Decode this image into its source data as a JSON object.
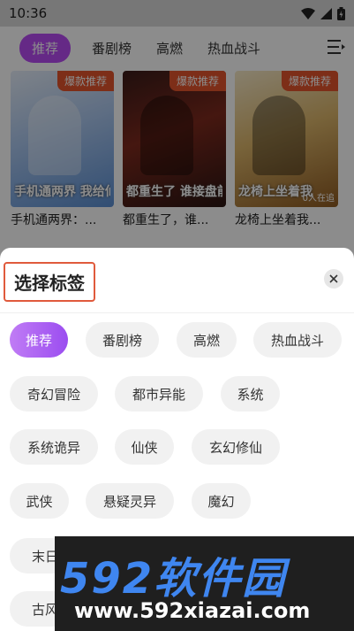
{
  "status_bar": {
    "time": "10:36"
  },
  "background": {
    "tabs": [
      "推荐",
      "番剧榜",
      "高燃",
      "热血战斗"
    ],
    "cards": [
      {
        "badge": "爆款推荐",
        "cover_text": "手机通两界 我给仙女送泡面",
        "title": "手机通两界：..."
      },
      {
        "badge": "爆款推荐",
        "cover_text": "都重生了 谁接盘前女友",
        "title": "都重生了，谁..."
      },
      {
        "badge": "爆款推荐",
        "cover_text": "龙椅上坐着我",
        "views": "0人在追",
        "title": "龙椅上坐着我..."
      }
    ]
  },
  "sheet": {
    "title": "选择标签",
    "tags": [
      {
        "label": "推荐",
        "selected": true
      },
      {
        "label": "番剧榜",
        "selected": false
      },
      {
        "label": "高燃",
        "selected": false
      },
      {
        "label": "热血战斗",
        "selected": false
      },
      {
        "label": "奇幻冒险",
        "selected": false
      },
      {
        "label": "都市异能",
        "selected": false
      },
      {
        "label": "系统",
        "selected": false
      },
      {
        "label": "系统诡异",
        "selected": false
      },
      {
        "label": "仙侠",
        "selected": false
      },
      {
        "label": "玄幻修仙",
        "selected": false
      },
      {
        "label": "武侠",
        "selected": false
      },
      {
        "label": "悬疑灵异",
        "selected": false
      },
      {
        "label": "魔幻",
        "selected": false
      },
      {
        "label": "末日",
        "selected": false
      },
      {
        "label": "古风",
        "selected": false
      }
    ]
  },
  "watermark": {
    "logo": "592软件园",
    "url": "www.592xiazai.com"
  },
  "colors": {
    "accent": "#b84cf5",
    "badge": "#e4552c",
    "highlight_border": "#e05a3c"
  }
}
